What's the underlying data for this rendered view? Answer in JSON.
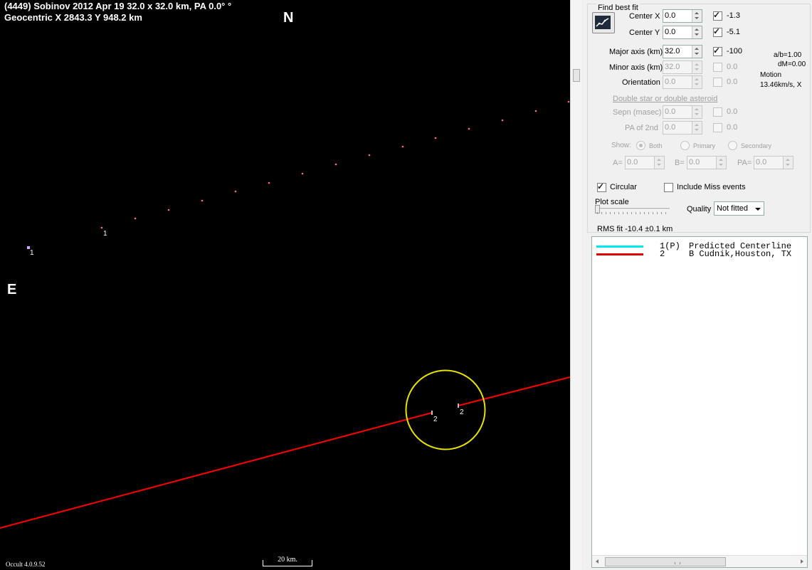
{
  "plot": {
    "header_line1": "(4449) Sobinov  2012 Apr 19   32.0 x 32.0 km,  PA 0.0° °",
    "header_line2": "Geocentric  X  2843.3  Y 948.2 km",
    "north_label": "N",
    "east_label": "E",
    "version": "Occult 4.0.9.52",
    "scale_label": "20 km.",
    "chord_labels": {
      "predicted_a": "1",
      "predicted_b": "1",
      "observer_a": "2",
      "observer_b": "2"
    },
    "colors": {
      "background": "#000000",
      "predicted_path": "#ff6b8a",
      "observer_chord": "#ff0000",
      "asteroid_outline": "#e8e000"
    }
  },
  "panel": {
    "find_best_fit": {
      "title": "Find best fit",
      "fit_button_icon": "fit-graph-icon",
      "center_x": {
        "label": "Center X",
        "value": "0.0",
        "checked": true,
        "result": "-1.3"
      },
      "center_y": {
        "label": "Center Y",
        "value": "0.0",
        "checked": true,
        "result": "-5.1"
      },
      "major_axis": {
        "label": "Major axis (km)",
        "value": "32.0",
        "checked": true,
        "result": "-100"
      },
      "minor_axis": {
        "label": "Minor axis (km)",
        "value": "32.0",
        "checked": false,
        "result": "0.0"
      },
      "orientation": {
        "label": "Orientation",
        "value": "0.0",
        "checked": false,
        "result": "0.0"
      },
      "ratio_ab": "a/b=1.00",
      "delta_m": "dM=0.00",
      "motion_label": "Motion",
      "motion_value": "13.46km/s, X"
    },
    "double_star": {
      "title": "Double star  or  double asteroid",
      "sepn": {
        "label": "Sepn (masec)",
        "value": "0.0",
        "result": "0.0"
      },
      "pa_2nd": {
        "label": "PA of 2nd",
        "value": "0.0",
        "result": "0.0"
      },
      "show_label": "Show:",
      "show_options": [
        "Both",
        "Primary",
        "Secondary"
      ],
      "a_label": "A=",
      "a_value": "0.0",
      "b_label": "B=",
      "b_value": "0.0",
      "pa_label": "PA=",
      "pa_value": "0.0"
    },
    "circular_label": "Circular",
    "circular_checked": true,
    "include_miss_label": "Include Miss events",
    "include_miss_checked": false,
    "plot_scale_label": "Plot scale",
    "quality_label": "Quality",
    "quality_value": "Not fitted",
    "rms_fit": "RMS fit -10.4 ±0.1 km",
    "legend": [
      {
        "num": "1(P)",
        "text": "Predicted Centerline",
        "color": "#00e8f0"
      },
      {
        "num": "2",
        "text": "B Cudnik,Houston, TX",
        "color": "#e00000"
      }
    ]
  }
}
